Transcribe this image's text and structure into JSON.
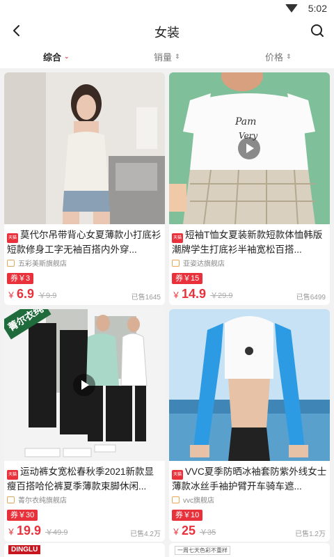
{
  "status": {
    "time": "5:02",
    "wifi_icon": "wifi-icon"
  },
  "nav": {
    "title": "女装",
    "back_icon": "back-arrow-icon",
    "search_icon": "search-icon"
  },
  "sort_tabs": [
    {
      "label": "综合",
      "active": true
    },
    {
      "label": "销量",
      "active": false
    },
    {
      "label": "价格",
      "active": false
    }
  ],
  "products": [
    {
      "title": "莫代尔吊带背心女夏薄款小打底衫短款修身工字无袖百搭内外穿...",
      "tmall_tag": "天猫",
      "shop": "五彩美斯旗舰店",
      "coupon": "券￥3",
      "currency": "￥",
      "price": "6.9",
      "original_price": "￥9.9",
      "sold": "已售1645",
      "has_video": false
    },
    {
      "title": "短袖T恤女夏装新款短款体恤韩版潮牌学生打底衫半袖宽松百搭...",
      "tmall_tag": "天猫",
      "shop": "亚姿达旗舰店",
      "coupon": "券￥15",
      "currency": "￥",
      "price": "14.9",
      "original_price": "￥29.9",
      "sold": "已售6499",
      "has_video": true
    },
    {
      "title": "运动裤女宽松春秋季2021新款显瘦百搭哈伦裤夏季薄款束脚休闲...",
      "tmall_tag": "天猫",
      "shop": "菁尔衣纯旗舰店",
      "coupon": "券￥30",
      "currency": "￥",
      "price": "19.9",
      "original_price": "￥49.9",
      "sold": "已售4.2万",
      "has_video": true,
      "image_badge": "菁尔衣纯"
    },
    {
      "title": "VVC夏季防晒冰袖套防紫外线女士薄款冰丝手袖护臂开车骑车遮...",
      "tmall_tag": "天猫",
      "shop": "vvc旗舰店",
      "coupon": "券￥10",
      "currency": "￥",
      "price": "25",
      "original_price": "￥35",
      "sold": "已售1.2万",
      "has_video": false
    }
  ],
  "next_row": {
    "brand": "DINGLU",
    "promo": "一周七天色彩不重样"
  },
  "colors": {
    "accent": "#e8313a",
    "background": "#f2f2f2"
  }
}
